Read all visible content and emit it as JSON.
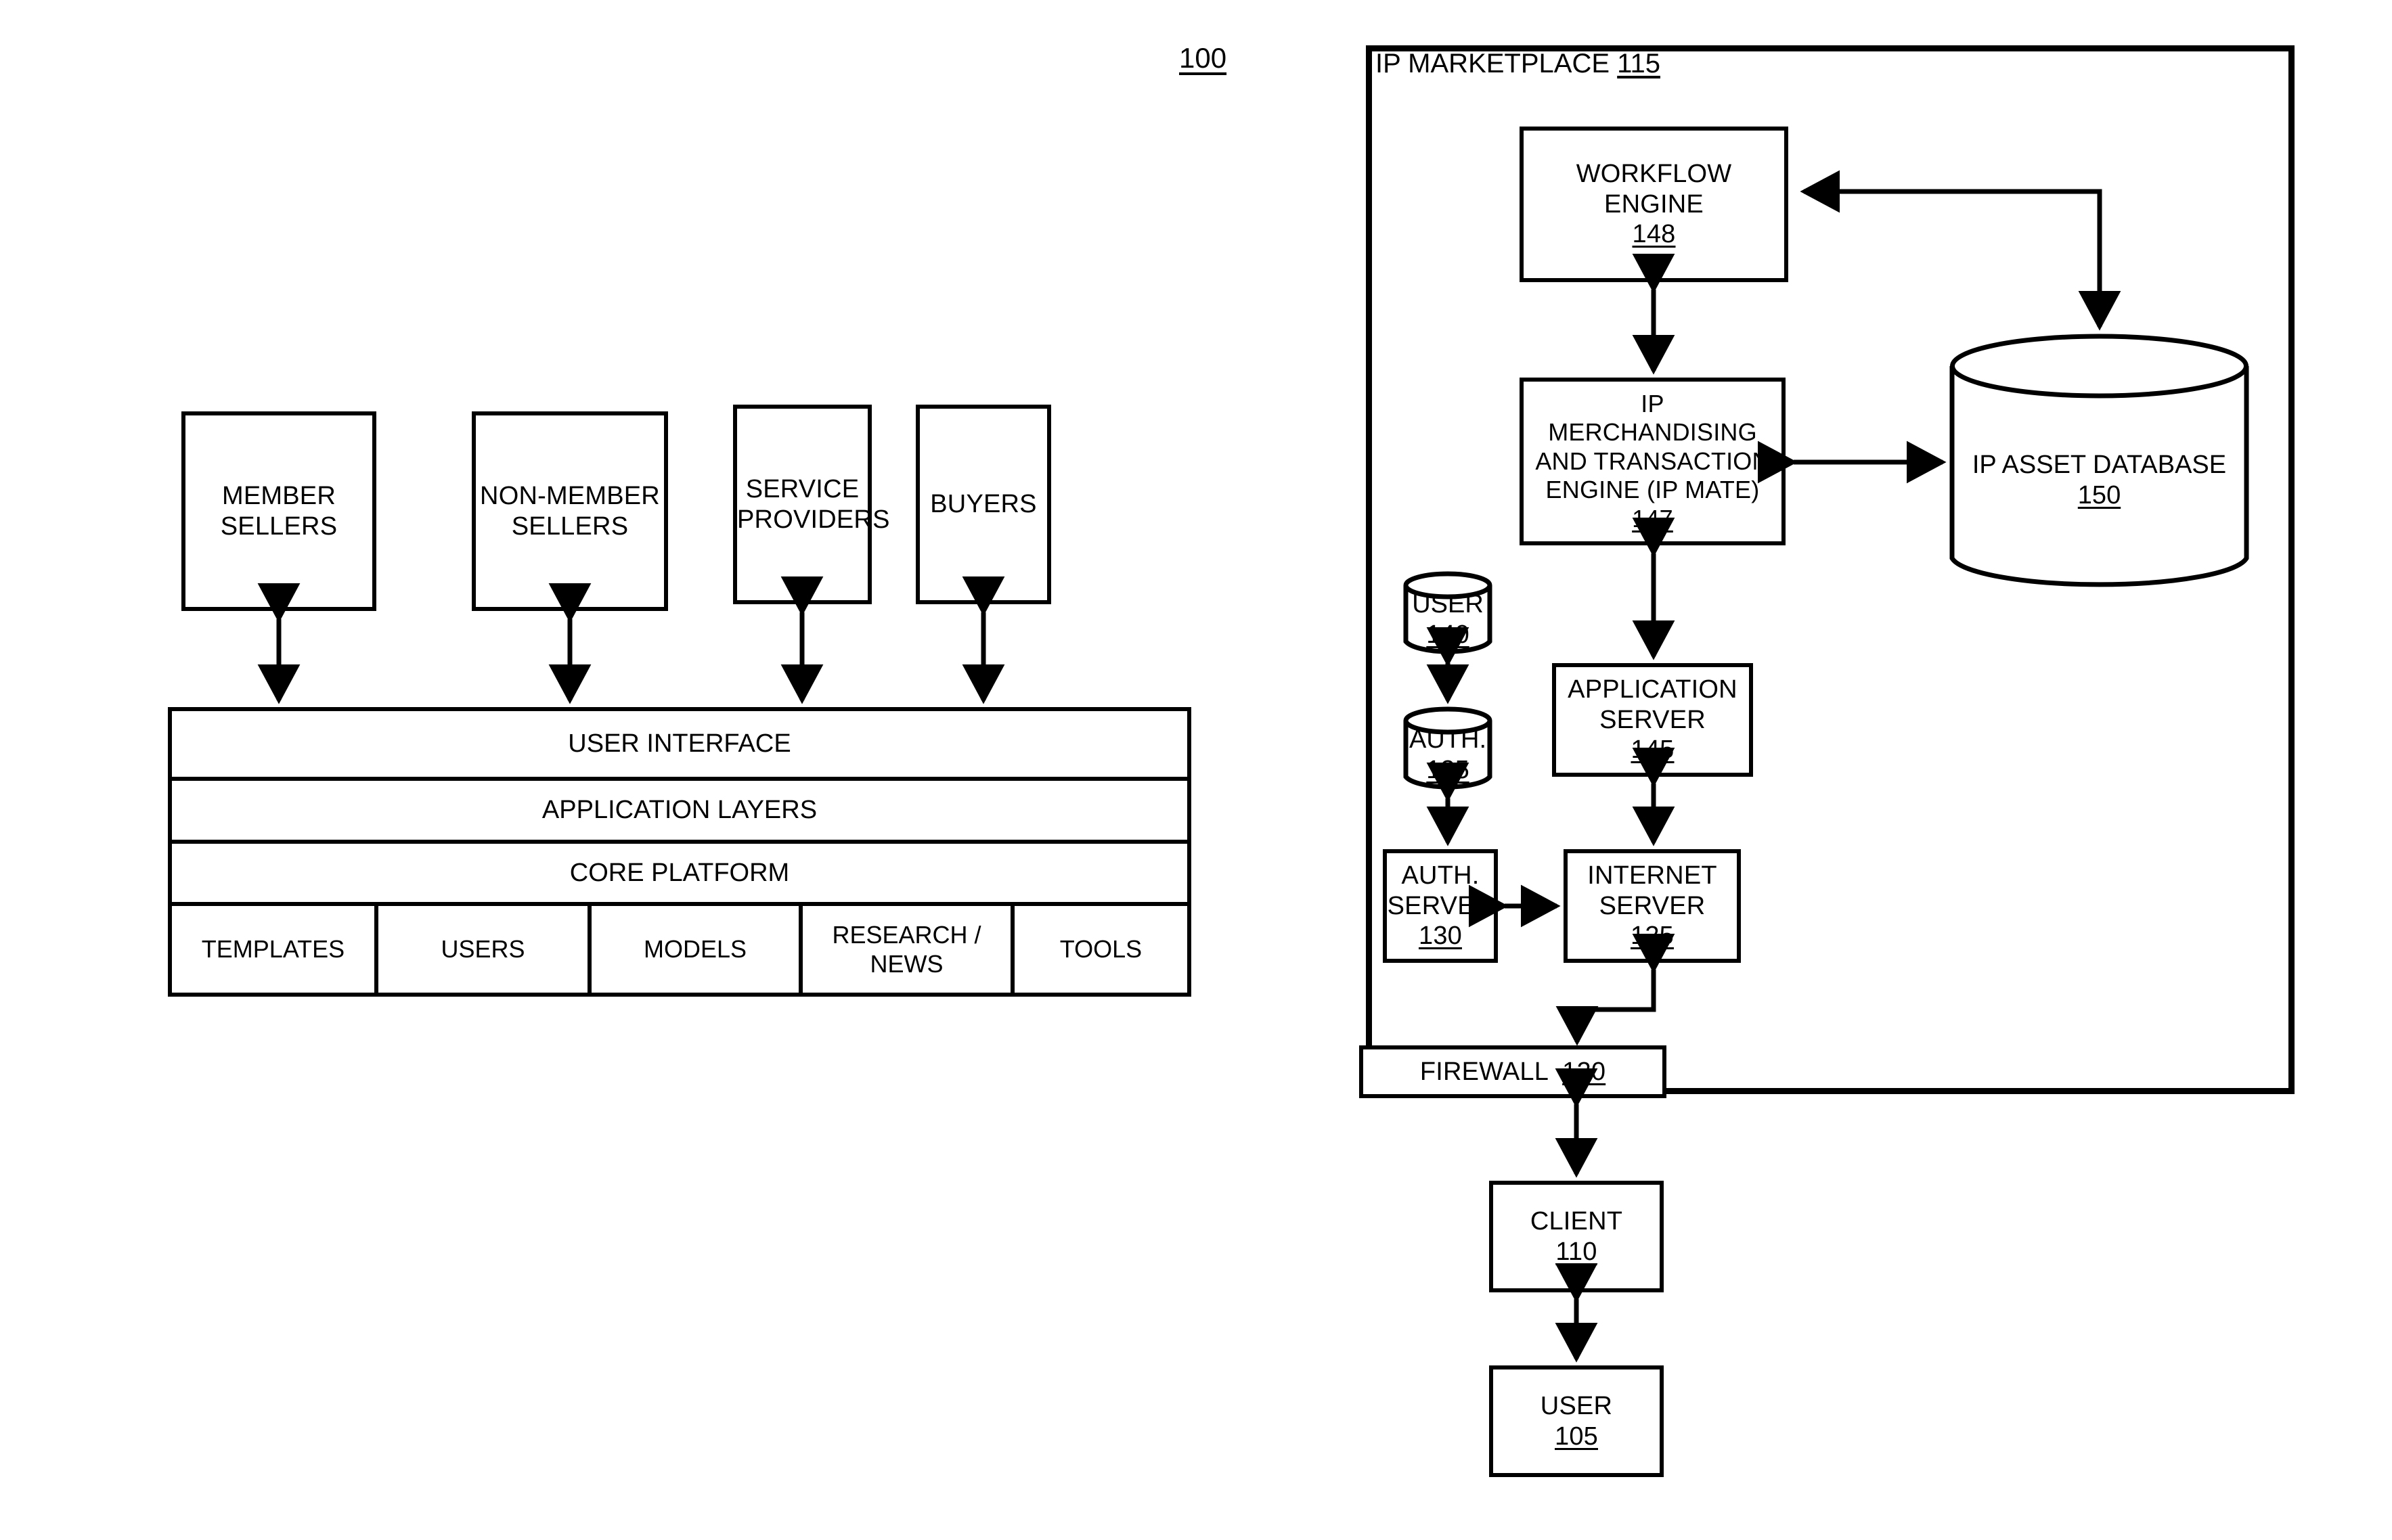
{
  "figure": {
    "number": "100"
  },
  "left_diagram": {
    "actors": [
      {
        "label": "MEMBER\nSELLERS",
        "line1": "MEMBER",
        "line2": "SELLERS"
      },
      {
        "label": "NON-MEMBER\nSELLERS",
        "line1": "NON-MEMBER",
        "line2": "SELLERS"
      },
      {
        "label": "SERVICE\nPROVIDERS",
        "line1": "SERVICE",
        "line2": "PROVIDERS"
      },
      {
        "label": "BUYERS",
        "line1": "BUYERS",
        "line2": ""
      }
    ],
    "stack": {
      "rows": [
        {
          "label": "USER INTERFACE"
        },
        {
          "label": "APPLICATION LAYERS"
        },
        {
          "label": "CORE PLATFORM"
        }
      ],
      "cells": [
        {
          "line1": "TEMPLATES",
          "line2": ""
        },
        {
          "line1": "USERS",
          "line2": ""
        },
        {
          "line1": "MODELS",
          "line2": ""
        },
        {
          "line1": "RESEARCH /",
          "line2": "NEWS"
        },
        {
          "line1": "TOOLS",
          "line2": ""
        }
      ]
    }
  },
  "marketplace": {
    "title_text": "IP MARKETPLACE",
    "title_ref": "115",
    "nodes": {
      "workflow_engine": {
        "line1": "WORKFLOW",
        "line2": "ENGINE",
        "ref": "148"
      },
      "ip_mate": {
        "line1": "IP",
        "line2": "MERCHANDISING",
        "line3": "AND TRANSACTION",
        "line4": "ENGINE (IP MATE)",
        "ref": "147"
      },
      "ip_asset_database": {
        "line1": "IP ASSET DATABASE",
        "ref": "150"
      },
      "user_db": {
        "line1": "USER",
        "ref": "140"
      },
      "auth_db": {
        "line1": "AUTH.",
        "ref": "135"
      },
      "application_server": {
        "line1": "APPLICATION",
        "line2": "SERVER",
        "ref": "145"
      },
      "auth_server": {
        "line1": "AUTH.",
        "line2": "SERVER",
        "ref": "130"
      },
      "internet_server": {
        "line1": "INTERNET",
        "line2": "SERVER",
        "ref": "125"
      },
      "firewall": {
        "line1": "FIREWALL",
        "ref": "120"
      }
    }
  },
  "external": {
    "client": {
      "line1": "CLIENT",
      "ref": "110"
    },
    "user": {
      "line1": "USER",
      "ref": "105"
    }
  },
  "style": {
    "stroke": "#000000",
    "background": "#ffffff"
  }
}
